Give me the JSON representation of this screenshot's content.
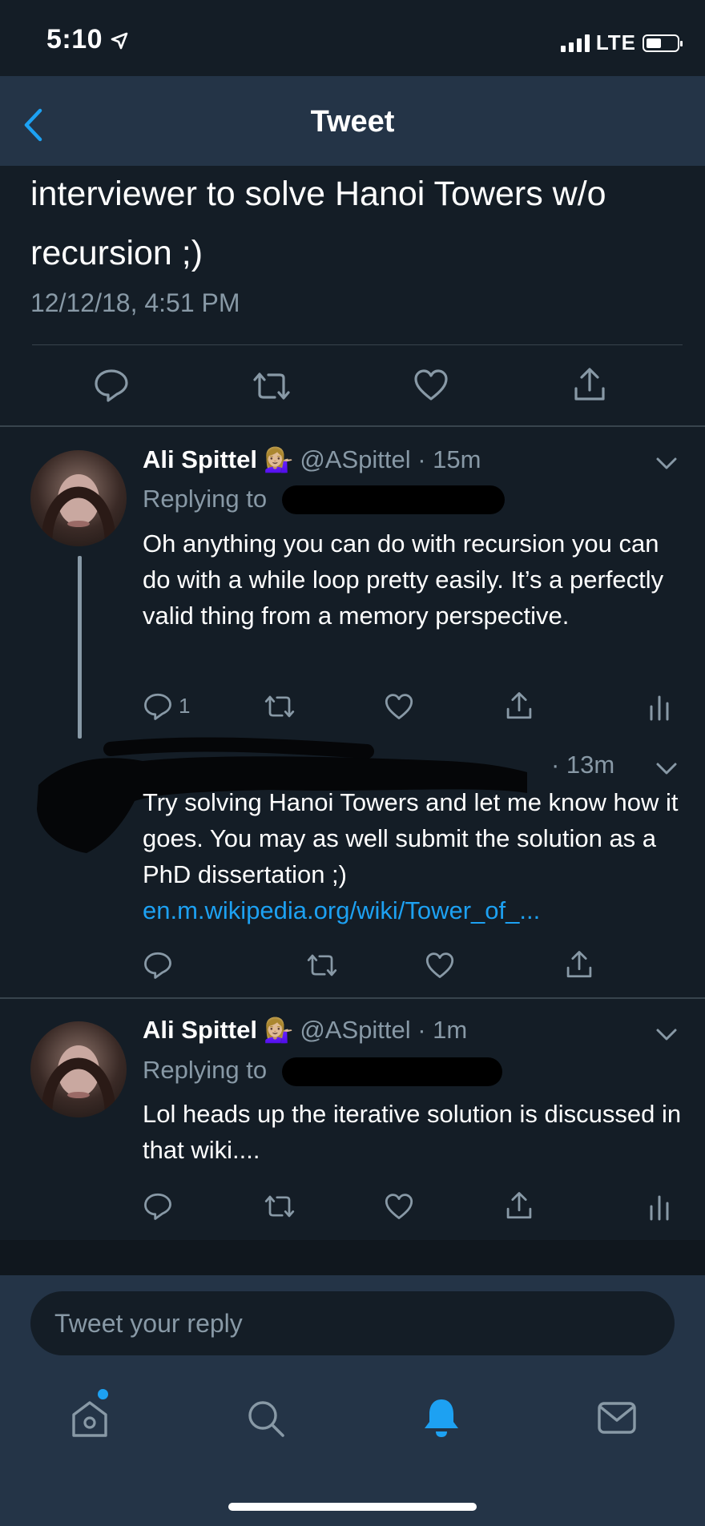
{
  "status": {
    "time": "5:10",
    "network": "LTE"
  },
  "header": {
    "title": "Tweet"
  },
  "main_tweet": {
    "text": "interviewer to solve Hanoi Towers w/o recursion ;)",
    "timestamp": "12/12/18, 4:51 PM"
  },
  "replies": [
    {
      "name": "Ali Spittel",
      "emoji": "💁🏼‍♀️",
      "handle": "@ASpittel · 15m",
      "replying_to": "Replying to",
      "text": "Oh anything you can do with recursion you can do with a while loop pretty easily. It’s a perfectly valid thing from a memory perspective.",
      "reply_count": "1"
    },
    {
      "handle_suffix": "· 13m",
      "text": "Try solving Hanoi Towers and let me know how it goes. You may as well submit the solution as a PhD dissertation ;)",
      "link": "en.m.wikipedia.org/wiki/Tower_of_..."
    },
    {
      "name": "Ali Spittel",
      "emoji": "💁🏼‍♀️",
      "handle": "@ASpittel · 1m",
      "replying_to": "Replying to",
      "text": "Lol heads up the iterative solution is discussed in that wiki...."
    }
  ],
  "composer": {
    "placeholder": "Tweet your reply"
  },
  "colors": {
    "background": "#141d26",
    "header": "#243447",
    "accent": "#1da1f2",
    "muted": "#8899a6"
  },
  "icons": [
    "location-arrow-icon",
    "back-chevron-icon",
    "reply-icon",
    "retweet-icon",
    "like-icon",
    "share-icon",
    "analytics-icon",
    "caret-down-icon",
    "home-icon",
    "search-icon",
    "notifications-icon",
    "messages-icon"
  ]
}
